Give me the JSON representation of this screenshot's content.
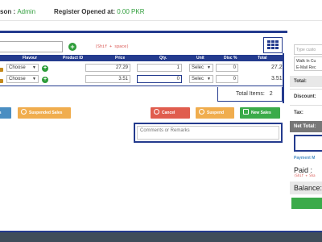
{
  "header": {
    "salesperson_label": "son : ",
    "salesperson_value": "Admin",
    "register_label": "Register Opened at: ",
    "register_value": "0.00 PKR"
  },
  "scan": {
    "hint": "(Shif + space)"
  },
  "table": {
    "columns": [
      "Flavour",
      "Product ID",
      "Price",
      "Qty.",
      "Unit",
      "Disc %",
      "Total"
    ],
    "rows": [
      {
        "flavour": "Choose",
        "product_id": "",
        "price": "27.29",
        "qty": "1",
        "unit": "Selec",
        "disc": "0",
        "total": "27.2"
      },
      {
        "flavour": "Choose",
        "product_id": "",
        "price": "3.51",
        "qty": "0",
        "unit": "Selec",
        "disc": "0",
        "total": "3.51"
      }
    ]
  },
  "summary": {
    "total_items_label": "Total Items:",
    "total_items_value": "2"
  },
  "buttons": {
    "left_partial": "es",
    "suspended_sales": "Suspended Sales",
    "cancel": "Cancel",
    "suspend": "Suspend",
    "new_sales": "New Sales"
  },
  "comments": {
    "placeholder": "Comments or Remarks"
  },
  "right_panel": {
    "customer_placeholder": "Type custo",
    "customer_name": "Walk In Cu",
    "customer_email": "E-Mail Rec",
    "total_label": "Total:",
    "discount_label": "Discount:",
    "tax_label": "Tax:",
    "net_total_label": "Net Total:",
    "payment_methods": "Payment M",
    "paid_label": "Paid :",
    "paid_hint": "(Shif + Sha",
    "balance_label": "Balance:"
  },
  "colors": {
    "accent": "#243b8e",
    "success": "#3bab4a",
    "warning": "#f0ad4e",
    "danger": "#e05d4e",
    "info": "#4a8ec2"
  }
}
